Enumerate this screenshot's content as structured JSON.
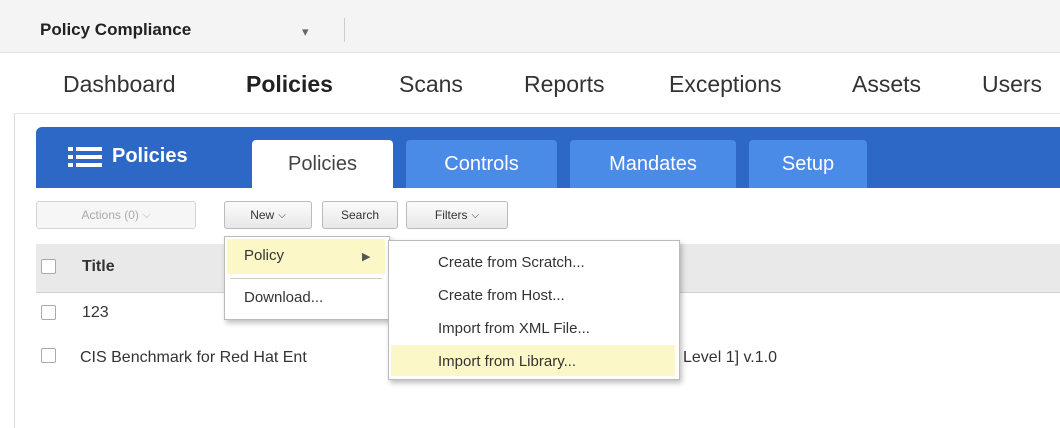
{
  "app": {
    "name": "Policy Compliance"
  },
  "topnav": {
    "items": [
      "Dashboard",
      "Policies",
      "Scans",
      "Reports",
      "Exceptions",
      "Assets",
      "Users"
    ],
    "active": "Policies"
  },
  "module": {
    "title": "Policies",
    "tabs": [
      "Policies",
      "Controls",
      "Mandates",
      "Setup"
    ],
    "active_tab": "Policies"
  },
  "toolbar": {
    "actions_label": "Actions (0)",
    "new_label": "New",
    "search_label": "Search",
    "filters_label": "Filters"
  },
  "table": {
    "header": {
      "title": "Title"
    },
    "rows": [
      {
        "title": "123"
      },
      {
        "title_visible_start": "CIS Benchmark for Red Hat Ent",
        "title_visible_end": "Level 1] v.1.0"
      }
    ]
  },
  "new_menu": {
    "items": [
      "Policy",
      "Download..."
    ],
    "highlighted": "Policy"
  },
  "policy_submenu": {
    "items": [
      "Create from Scratch...",
      "Create from Host...",
      "Import from XML File...",
      "Import from Library..."
    ],
    "highlighted": "Import from Library..."
  },
  "colors": {
    "module_bar": "#2e68c7",
    "tab_inactive": "#4b8be8",
    "menu_highlight": "#fbf7c7"
  }
}
